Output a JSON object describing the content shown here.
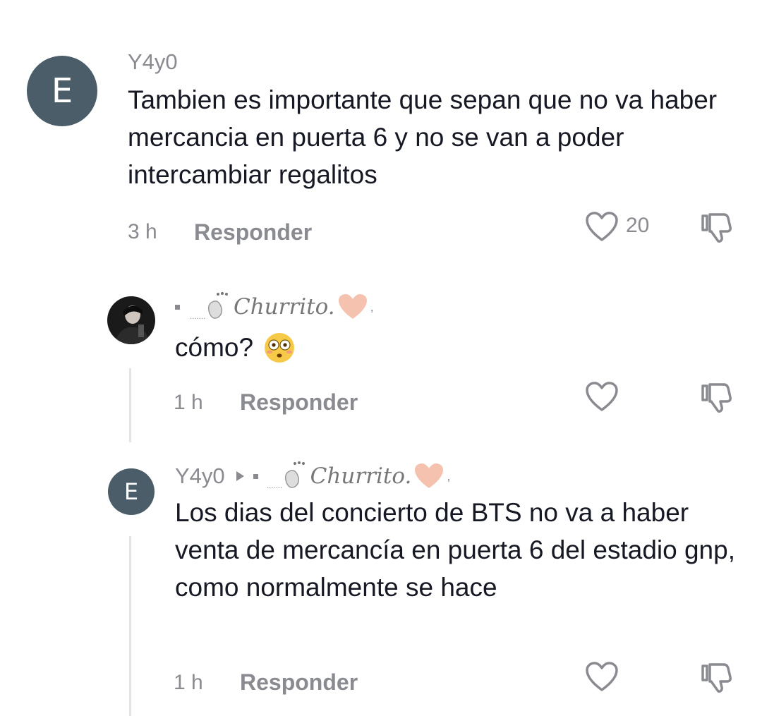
{
  "comments": [
    {
      "avatar_letter": "E",
      "username": "Y4y0",
      "text": "Tambien es importante que sepan que no va haber mercancia en puerta 6 y no se van a poder intercambiar regalitos",
      "time": "3 h",
      "reply_label": "Responder",
      "like_count": "20"
    },
    {
      "username_prefix": "·",
      "username": "Churrito.",
      "text": "cómo?",
      "time": "1 h",
      "reply_label": "Responder"
    },
    {
      "avatar_letter": "E",
      "username": "Y4y0",
      "reply_to": "Churrito.",
      "text": "Los dias del concierto de BTS no va a haber venta de mercancía en puerta 6 del estadio gnp, como normalmente se hace",
      "time": "1 h",
      "reply_label": "Responder"
    }
  ],
  "icons": {
    "like": "heart-outline-icon",
    "dislike": "thumbs-down-icon",
    "emoji": "flushed-face-emoji",
    "arrow": "triangle-right-icon",
    "decor": "cat-sticker-icon",
    "heart_emoji": "pink-heart-emoji"
  },
  "colors": {
    "avatar_bg": "#4a5d68",
    "muted_text": "#8a8b91",
    "body_text": "#161823",
    "thread_line": "#e4e4e6"
  }
}
